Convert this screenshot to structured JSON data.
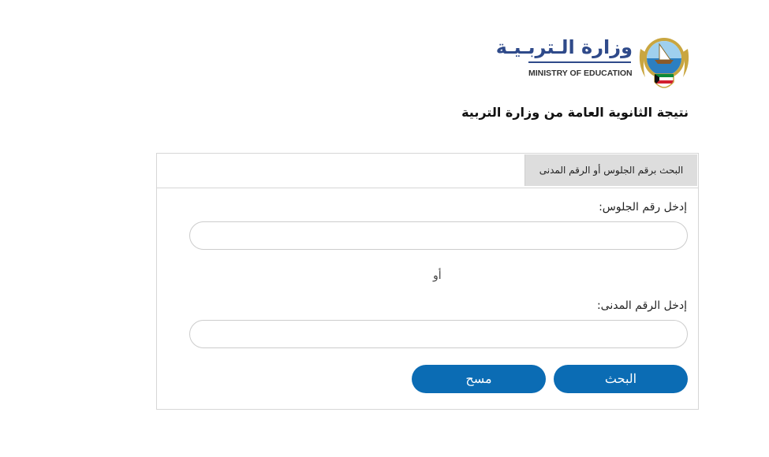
{
  "header": {
    "logo_ar": "وزارة الـتربـيـة",
    "logo_en": "MINISTRY OF EDUCATION",
    "emblem_icon": "kuwait-emblem-icon",
    "page_title": "نتيجة الثانوية العامة من وزارة التربية"
  },
  "tabs": [
    {
      "label": "البحث برقم الجلوس أو الرقم المدنى",
      "active": true
    }
  ],
  "form": {
    "seat_number_label": "إدخل رقم الجلوس:",
    "seat_number_value": "",
    "or_label": "أو",
    "civil_id_label": "إدخل الرقم المدنى:",
    "civil_id_value": "",
    "search_button": "البحث",
    "clear_button": "مسح"
  },
  "colors": {
    "button": "#0b6cb4",
    "logo_blue": "#2f4a8a",
    "tab_bg": "#dddddd",
    "border": "#d6d6d6"
  }
}
